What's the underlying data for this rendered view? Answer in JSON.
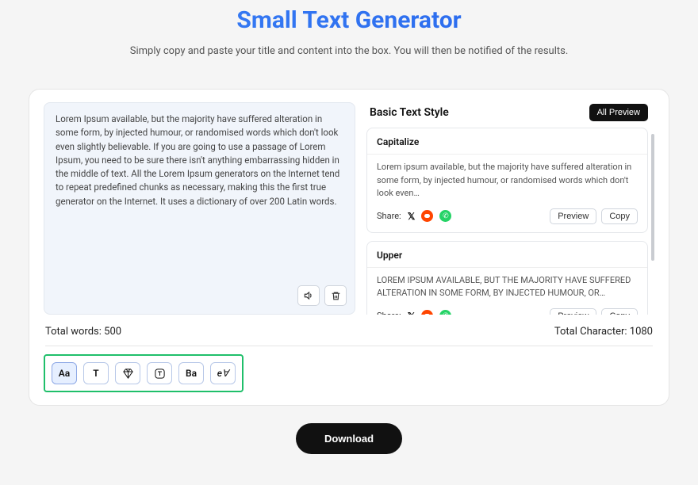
{
  "title": "Small Text Generator",
  "subtitle": "Simply copy and paste your title and content into the box. You will then be notified of the results.",
  "input_text": "Lorem Ipsum available, but the majority have suffered alteration in some form, by injected humour, or randomised words which don't look even slightly believable. If you are going to use a passage of Lorem Ipsum, you need to be sure there isn't anything embarrassing hidden in the middle of text. All the Lorem Ipsum generators on the Internet tend to repeat predefined chunks as necessary, making this the first true generator on the Internet. It uses a dictionary of over 200 Latin words.",
  "right": {
    "heading": "Basic Text Style",
    "all_preview": "All Preview"
  },
  "styles": [
    {
      "name": "Capitalize",
      "body": "Lorem ipsum available, but the majority have suffered alteration in some form, by injected humour, or randomised words which don't look even…"
    },
    {
      "name": "Upper",
      "body": "LOREM IPSUM AVAILABLE, BUT THE MAJORITY HAVE SUFFERED ALTERATION IN SOME FORM, BY INJECTED HUMOUR, OR…"
    }
  ],
  "share_label": "Share:",
  "preview_label": "Preview",
  "copy_label": "Copy",
  "stats": {
    "words_label": "Total words: ",
    "words_value": "500",
    "chars_label": "Total Character: ",
    "chars_value": "1080"
  },
  "toggles": [
    "Aa",
    "T",
    "diamond",
    "t-circle",
    "Ba",
    "ev"
  ],
  "download_label": "Download"
}
